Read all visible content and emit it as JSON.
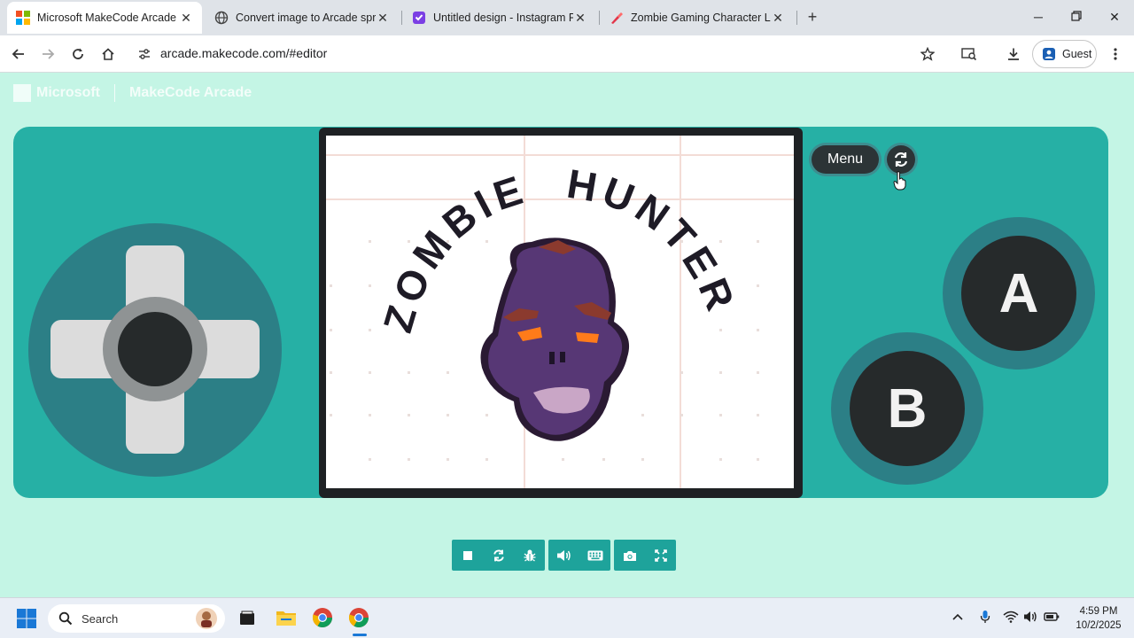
{
  "browser": {
    "tabs": [
      {
        "title": "Microsoft MakeCode Arcade",
        "active": true
      },
      {
        "title": "Convert image to Arcade sprite",
        "active": false
      },
      {
        "title": "Untitled design - Instagram Po",
        "active": false
      },
      {
        "title": "Zombie Gaming Character Logo",
        "active": false
      }
    ],
    "url": "arcade.makecode.com/#editor",
    "profile_label": "Guest"
  },
  "app": {
    "brand": "Microsoft",
    "product": "MakeCode Arcade"
  },
  "game": {
    "title_left": "ZOMBIE",
    "title_right": "HUNTER"
  },
  "controls": {
    "menu_label": "Menu",
    "a_label": "A",
    "b_label": "B"
  },
  "toolbar": [
    "stop",
    "restart",
    "debug",
    "sound",
    "keyboard",
    "screenshot",
    "fullscreen"
  ],
  "taskbar": {
    "search_placeholder": "Search",
    "time": "4:59 PM",
    "date": "10/2/2025"
  },
  "colors": {
    "page_bg": "#c4f5e5",
    "console": "#26b0a5",
    "zombie_face": "#573775",
    "zombie_eye": "#ff7b1a",
    "zombie_brow": "#8b3a2e"
  }
}
